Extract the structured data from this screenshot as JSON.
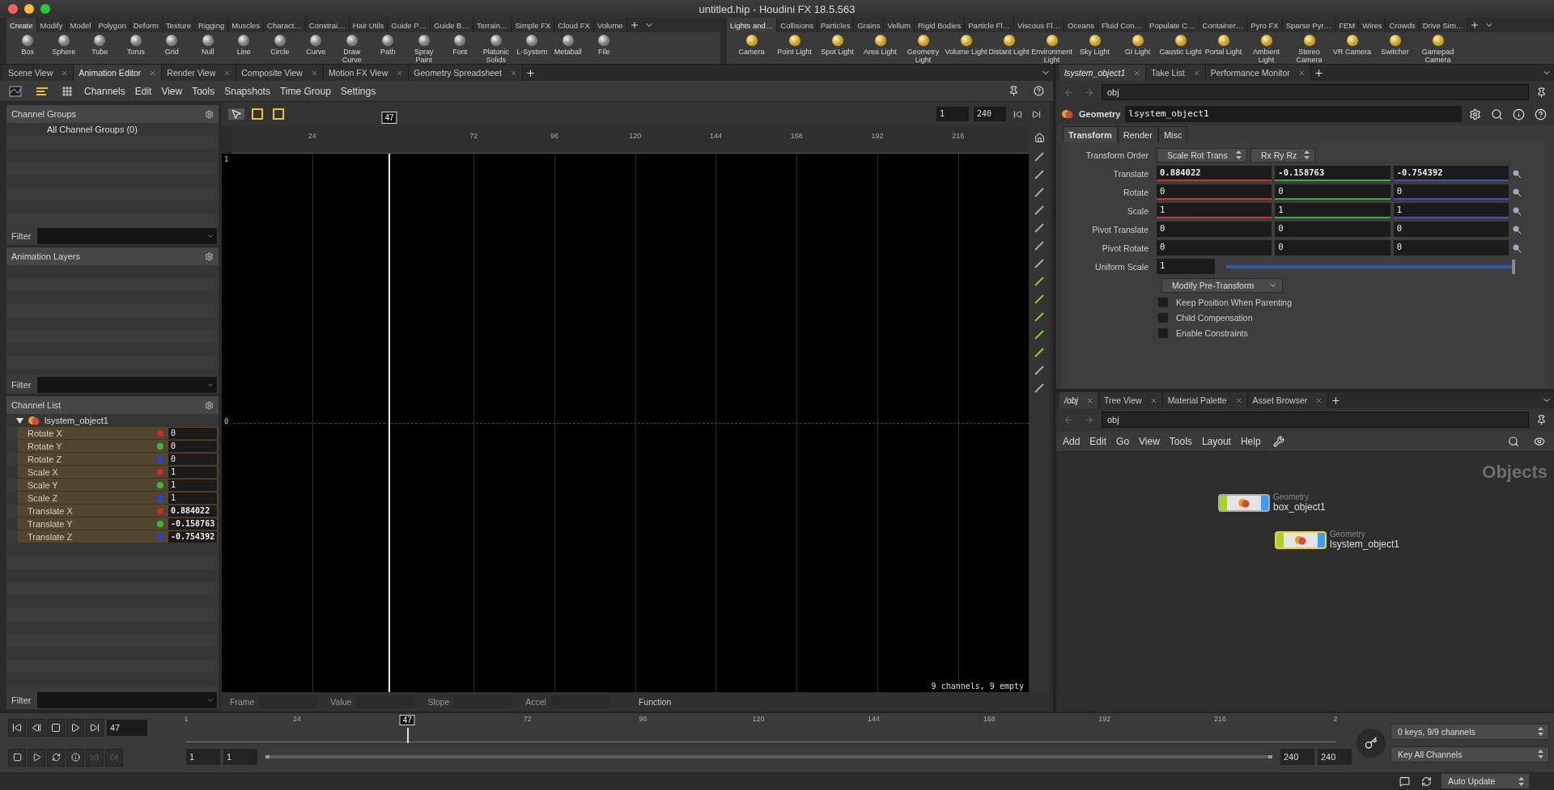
{
  "window": {
    "title": "untitled.hip - Houdini FX 18.5.563"
  },
  "shelves": [
    {
      "tabs": [
        {
          "label": "Create",
          "selected": true
        },
        {
          "label": "Modify",
          "selected": false
        },
        {
          "label": "Model",
          "selected": false
        },
        {
          "label": "Polygon",
          "selected": false
        },
        {
          "label": "Deform",
          "selected": false
        },
        {
          "label": "Texture",
          "selected": false
        },
        {
          "label": "Rigging",
          "selected": false
        },
        {
          "label": "Muscles",
          "selected": false
        },
        {
          "label": "Charact…",
          "selected": false
        },
        {
          "label": "Constrai…",
          "selected": false
        },
        {
          "label": "Hair Utils",
          "selected": false
        },
        {
          "label": "Guide P…",
          "selected": false
        },
        {
          "label": "Guide B…",
          "selected": false
        },
        {
          "label": "Terrain…",
          "selected": false
        },
        {
          "label": "Simple FX",
          "selected": false
        },
        {
          "label": "Cloud FX",
          "selected": false
        },
        {
          "label": "Volume",
          "selected": false
        }
      ],
      "tools": [
        "Box",
        "Sphere",
        "Tube",
        "Torus",
        "Grid",
        "Null",
        "Line",
        "Circle",
        "Curve",
        "Draw Curve",
        "Path",
        "Spray Paint",
        "Font",
        "Platonic Solids",
        "L-System",
        "Metaball",
        "File"
      ]
    },
    {
      "tabs": [
        {
          "label": "Lights and…",
          "selected": true
        },
        {
          "label": "Collisions",
          "selected": false
        },
        {
          "label": "Particles",
          "selected": false
        },
        {
          "label": "Grains",
          "selected": false
        },
        {
          "label": "Vellum",
          "selected": false
        },
        {
          "label": "Rigid Bodies",
          "selected": false
        },
        {
          "label": "Particle Fl…",
          "selected": false
        },
        {
          "label": "Viscous Fl…",
          "selected": false
        },
        {
          "label": "Oceans",
          "selected": false
        },
        {
          "label": "Fluid Con…",
          "selected": false
        },
        {
          "label": "Populate C…",
          "selected": false
        },
        {
          "label": "Container…",
          "selected": false
        },
        {
          "label": "Pyro FX",
          "selected": false
        },
        {
          "label": "Sparse Pyr…",
          "selected": false
        },
        {
          "label": "FEM",
          "selected": false
        },
        {
          "label": "Wires",
          "selected": false
        },
        {
          "label": "Crowds",
          "selected": false
        },
        {
          "label": "Drive Sim…",
          "selected": false
        }
      ],
      "tools": [
        "Camera",
        "Point Light",
        "Spot Light",
        "Area Light",
        "Geometry Light",
        "Volume Light",
        "Distant Light",
        "Environment Light",
        "Sky Light",
        "GI Light",
        "Caustic Light",
        "Portal Light",
        "Ambient Light",
        "Stereo Camera",
        "VR Camera",
        "Switcher",
        "Gamepad Camera"
      ]
    }
  ],
  "left_pane": {
    "tabs": [
      {
        "label": "Scene View",
        "selected": false
      },
      {
        "label": "Animation Editor",
        "selected": true
      },
      {
        "label": "Render View",
        "selected": false
      },
      {
        "label": "Composite View",
        "selected": false
      },
      {
        "label": "Motion FX View",
        "selected": false
      },
      {
        "label": "Geometry Spreadsheet",
        "selected": false
      }
    ],
    "menu": [
      "Channels",
      "Edit",
      "View",
      "Tools",
      "Snapshots",
      "Time Group",
      "Settings"
    ]
  },
  "channel_groups": {
    "title": "Channel Groups",
    "items": [
      "All Channel Groups (0)"
    ],
    "filter_label": "Filter"
  },
  "animation_layers": {
    "title": "Animation Layers",
    "filter_label": "Filter"
  },
  "channel_list": {
    "title": "Channel List",
    "object": "lsystem_object1",
    "expanded": true,
    "filter_label": "Filter",
    "channels": [
      {
        "name": "Rotate X",
        "color": "#d02a2a",
        "value": "0",
        "modified": false
      },
      {
        "name": "Rotate Y",
        "color": "#3cb83c",
        "value": "0",
        "modified": false
      },
      {
        "name": "Rotate Z",
        "color": "#2a44d0",
        "value": "0",
        "modified": false
      },
      {
        "name": "Scale X",
        "color": "#d02a2a",
        "value": "1",
        "modified": false
      },
      {
        "name": "Scale Y",
        "color": "#3cb83c",
        "value": "1",
        "modified": false
      },
      {
        "name": "Scale Z",
        "color": "#2a44d0",
        "value": "1",
        "modified": false
      },
      {
        "name": "Translate X",
        "color": "#d02a2a",
        "value": "0.884022",
        "modified": true
      },
      {
        "name": "Translate Y",
        "color": "#3cb83c",
        "value": "-0.158763",
        "modified": true
      },
      {
        "name": "Translate Z",
        "color": "#2a44d0",
        "value": "-0.754392",
        "modified": true
      }
    ]
  },
  "graph": {
    "start": "1",
    "end": "240",
    "ruler_ticks": [
      "24",
      "72",
      "96",
      "120",
      "144",
      "168",
      "192",
      "216"
    ],
    "playhead": {
      "label": "47",
      "level": 0.198
    },
    "y_labels": [
      "1",
      "0"
    ],
    "summary": "9 channels, 9 empty",
    "fields": [
      "Frame",
      "Value",
      "Slope",
      "Accel"
    ],
    "function_label": "Function"
  },
  "param_pane": {
    "tabs": [
      {
        "label": "lsystem_object1",
        "selected": true
      },
      {
        "label": "Take List",
        "selected": false
      },
      {
        "label": "Performance Monitor",
        "selected": false
      }
    ],
    "path": "obj",
    "node_type": "Geometry",
    "node_name": "lsystem_object1",
    "param_tabs": [
      {
        "label": "Transform",
        "selected": true
      },
      {
        "label": "Render",
        "selected": false
      },
      {
        "label": "Misc",
        "selected": false
      }
    ],
    "transform_order": {
      "label": "Transform Order",
      "values": [
        "Scale Rot Trans",
        "Rx Ry Rz"
      ]
    },
    "vectors": [
      {
        "label": "Translate",
        "values": [
          "0.884022",
          "-0.158763",
          "-0.754392"
        ],
        "axis_colors": true,
        "modified": true
      },
      {
        "label": "Rotate",
        "values": [
          "0",
          "0",
          "0"
        ],
        "axis_colors": true,
        "modified": false
      },
      {
        "label": "Scale",
        "values": [
          "1",
          "1",
          "1"
        ],
        "axis_colors": true,
        "modified": false
      },
      {
        "label": "Pivot Translate",
        "values": [
          "0",
          "0",
          "0"
        ],
        "axis_colors": false,
        "modified": false
      },
      {
        "label": "Pivot Rotate",
        "values": [
          "0",
          "0",
          "0"
        ],
        "axis_colors": false,
        "modified": false
      }
    ],
    "uniform_scale": {
      "label": "Uniform Scale",
      "value": "1",
      "level": 1
    },
    "menu_button": "Modify Pre-Transform",
    "checkboxes": [
      {
        "label": "Keep Position When Parenting",
        "checked": false
      },
      {
        "label": "Child Compensation",
        "checked": false
      },
      {
        "label": "Enable Constraints",
        "checked": false
      }
    ]
  },
  "network_pane": {
    "tabs": [
      {
        "label": "/obj",
        "selected": true
      },
      {
        "label": "Tree View",
        "selected": false
      },
      {
        "label": "Material Palette",
        "selected": false
      },
      {
        "label": "Asset Browser",
        "selected": false
      }
    ],
    "path": "obj",
    "menu": [
      "Add",
      "Edit",
      "Go",
      "View",
      "Tools",
      "Layout",
      "Help"
    ],
    "context_label": "Objects",
    "nodes": [
      {
        "type": "Geometry",
        "name": "box_object1",
        "selected": false
      },
      {
        "type": "Geometry",
        "name": "lsystem_object1",
        "selected": true
      }
    ]
  },
  "timeline": {
    "frame": "47",
    "ticks": [
      "1",
      "24",
      "72",
      "96",
      "120",
      "144",
      "168",
      "192",
      "216",
      "2"
    ],
    "playhead": {
      "label": "47",
      "level": 0.1925
    },
    "range": {
      "start": "1",
      "range_start": "1",
      "range_end": "240",
      "end": "240",
      "level": 1
    },
    "keys_info": "0 keys, 9/9 channels",
    "key_menu": "Key All Channels"
  },
  "status_bar": {
    "update_mode": "Auto Update"
  }
}
